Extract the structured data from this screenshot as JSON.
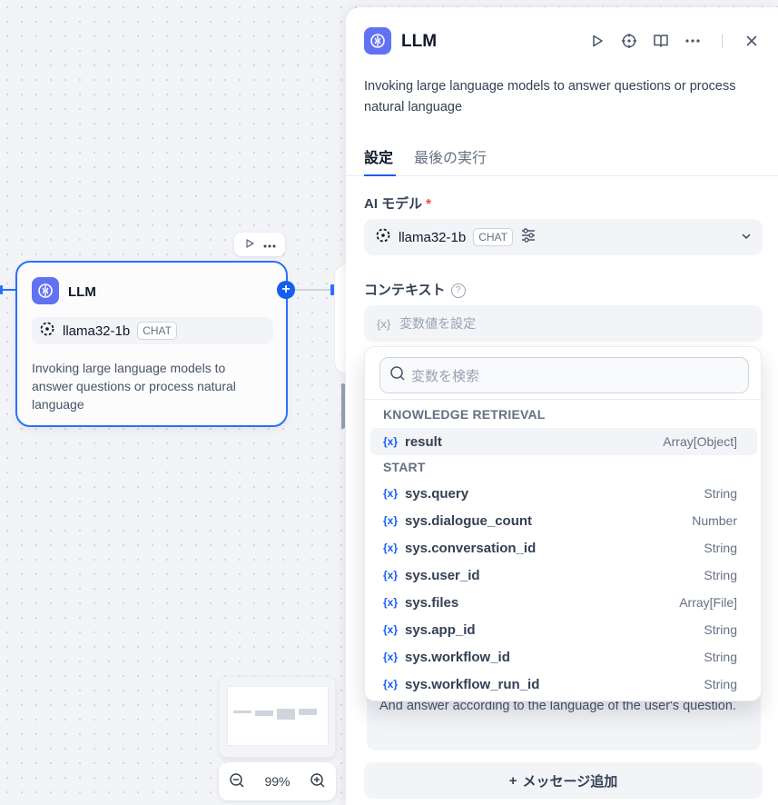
{
  "canvas": {
    "node": {
      "title": "LLM",
      "model": "llama32-1b",
      "model_tag": "CHAT",
      "description": "Invoking large language models to answer questions or process natural language"
    },
    "zoom_level": "99%",
    "add_symbol": "+"
  },
  "panel": {
    "title": "LLM",
    "description": "Invoking large language models to answer questions or process natural language",
    "tabs": [
      {
        "label": "設定",
        "active": true
      },
      {
        "label": "最後の実行",
        "active": false
      }
    ],
    "model_label": "AI モデル",
    "required_mark": "*",
    "model_name": "llama32-1b",
    "model_tag": "CHAT",
    "context_label": "コンテキスト",
    "context_icon": "{x}",
    "context_placeholder": "変数値を設定",
    "prompt_text": "And answer according to the language of the user's question.",
    "add_message_label": "メッセージ追加",
    "add_message_symbol": "+"
  },
  "variable_picker": {
    "search_placeholder": "変数を検索",
    "var_icon": "{x}",
    "groups": [
      {
        "title": "KNOWLEDGE RETRIEVAL",
        "items": [
          {
            "name": "result",
            "type": "Array[Object]"
          }
        ]
      },
      {
        "title": "START",
        "items": [
          {
            "name": "sys.query",
            "type": "String"
          },
          {
            "name": "sys.dialogue_count",
            "type": "Number"
          },
          {
            "name": "sys.conversation_id",
            "type": "String"
          },
          {
            "name": "sys.user_id",
            "type": "String"
          },
          {
            "name": "sys.files",
            "type": "Array[File]"
          },
          {
            "name": "sys.app_id",
            "type": "String"
          },
          {
            "name": "sys.workflow_id",
            "type": "String"
          },
          {
            "name": "sys.workflow_run_id",
            "type": "String"
          }
        ]
      }
    ]
  },
  "colors": {
    "accent": "#155eef",
    "llm_badge": "#6172f3",
    "required": "#f04438"
  },
  "icons": [
    "llm-brain-icon",
    "play-icon",
    "locate-icon",
    "book-icon",
    "more-icon",
    "close-icon",
    "model-icon",
    "settings-sliders-icon",
    "chevron-down-icon",
    "help-icon",
    "search-icon",
    "zoom-in-icon",
    "zoom-out-icon",
    "variable-icon"
  ]
}
